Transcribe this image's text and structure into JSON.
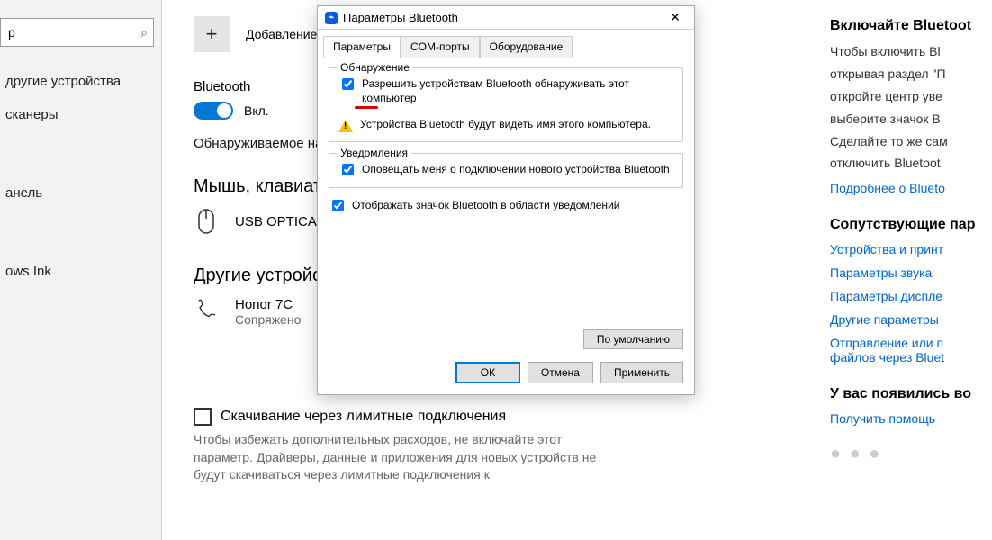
{
  "sidebar": {
    "search_placeholder": "р",
    "items": [
      "другие устройства",
      "сканеры",
      "анель",
      "ows Ink"
    ]
  },
  "main": {
    "add_label": "Добавление",
    "bt_label": "Bluetooth",
    "bt_on": "Вкл.",
    "discover_text": "Обнаруживаемое на",
    "mouse_heading": "Мышь, клавиату",
    "mouse_device": "USB OPTICAL",
    "other_heading": "Другие устройс",
    "phone_name": "Honor 7C",
    "phone_status": "Сопряжено",
    "metered_label": "Скачивание через лимитные подключения",
    "metered_help": "Чтобы избежать дополнительных расходов, не включайте этот параметр. Драйверы, данные и приложения для новых устройств не будут скачиваться через лимитные подключения к"
  },
  "right": {
    "h1": "Включайте Bluetoot",
    "lines": [
      "Чтобы включить Bl",
      "открывая раздел \"П",
      "откройте центр уве",
      "выберите значок B",
      "Сделайте то же сам",
      "отключить Bluetoot"
    ],
    "more_link": "Подробнее о Blueto",
    "h2": "Сопутствующие пар",
    "links": [
      "Устройства и принт",
      "Параметры звука",
      "Параметры диспле",
      "Другие параметры",
      "Отправление или п файлов через Bluet"
    ],
    "h3": "У вас появились во",
    "help_link": "Получить помощь"
  },
  "dialog": {
    "title": "Параметры Bluetooth",
    "tabs": [
      "Параметры",
      "COM-порты",
      "Оборудование"
    ],
    "group_discovery": "Обнаружение",
    "chk_allow": "Разрешить устройствам Bluetooth обнаруживать этот компьютер",
    "warn_text": "Устройства Bluetooth будут видеть имя этого компьютера.",
    "group_notify": "Уведомления",
    "chk_notify": "Оповещать меня о подключении нового устройства Bluetooth",
    "chk_tray": "Отображать значок Bluetooth в области уведомлений",
    "btn_default": "По умолчанию",
    "btn_ok": "ОК",
    "btn_cancel": "Отмена",
    "btn_apply": "Применить"
  }
}
